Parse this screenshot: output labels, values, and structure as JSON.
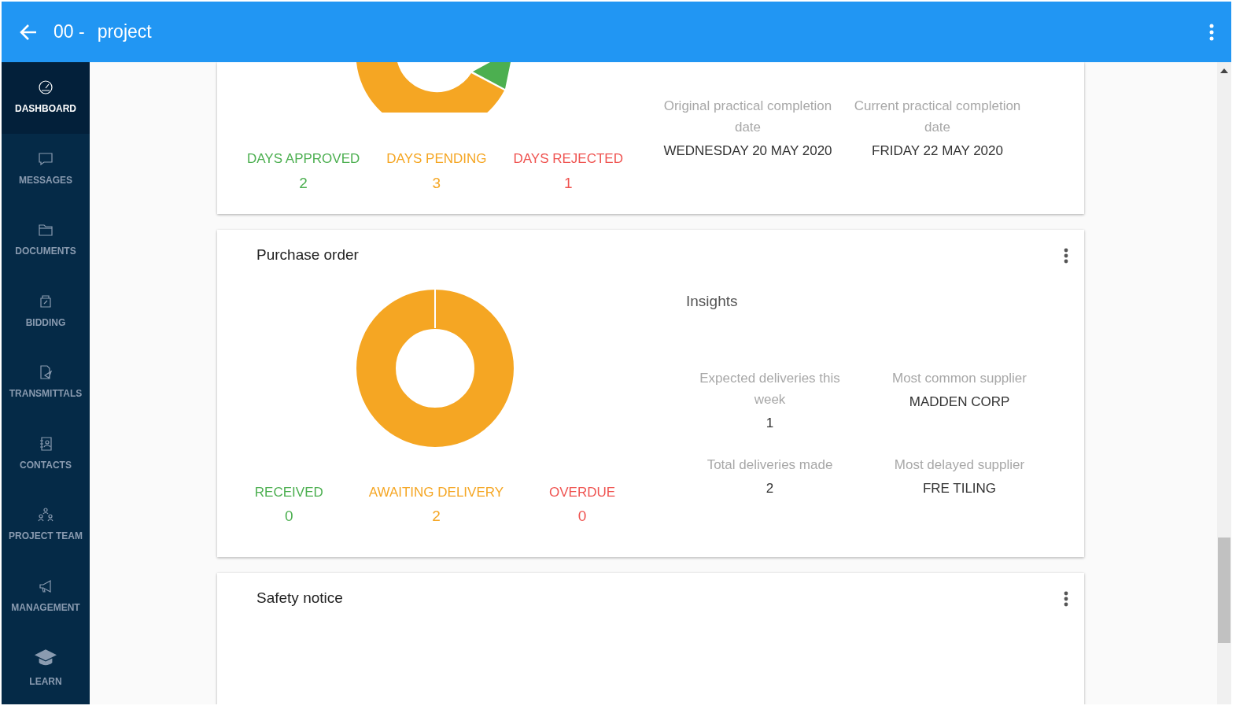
{
  "header": {
    "number": "00 -",
    "title": "project"
  },
  "sidebar": {
    "items": [
      {
        "label": "DASHBOARD",
        "kind": "gauge",
        "selected": true
      },
      {
        "label": "MESSAGES",
        "kind": "chat",
        "selected": false
      },
      {
        "label": "DOCUMENTS",
        "kind": "folder",
        "selected": false
      },
      {
        "label": "BIDDING",
        "kind": "bid",
        "selected": false
      },
      {
        "label": "TRANSMITTALS",
        "kind": "send",
        "selected": false
      },
      {
        "label": "CONTACTS",
        "kind": "contacts",
        "selected": false
      },
      {
        "label": "PROJECT TEAM",
        "kind": "team",
        "selected": false
      },
      {
        "label": "MANAGEMENT",
        "kind": "megaphone",
        "selected": false
      },
      {
        "label": "LEARN",
        "kind": "cap",
        "selected": false
      }
    ]
  },
  "time_card": {
    "stats": [
      {
        "label": "DAYS APPROVED",
        "value": "2",
        "color": "#4caf50"
      },
      {
        "label": "DAYS PENDING",
        "value": "3",
        "color": "#f5a623"
      },
      {
        "label": "DAYS REJECTED",
        "value": "1",
        "color": "#ef5350"
      }
    ],
    "insights": [
      {
        "label": "Original practical completion date",
        "value": "WEDNESDAY 20 MAY 2020"
      },
      {
        "label": "Current practical completion date",
        "value": "FRIDAY 22 MAY 2020"
      }
    ]
  },
  "purchase_card": {
    "title": "Purchase order",
    "stats": [
      {
        "label": "RECEIVED",
        "value": "0",
        "color": "#4caf50"
      },
      {
        "label": "AWAITING DELIVERY",
        "value": "2",
        "color": "#f5a623"
      },
      {
        "label": "OVERDUE",
        "value": "0",
        "color": "#ef5350"
      }
    ],
    "insights_title": "Insights",
    "insights": [
      {
        "label": "Expected deliveries this week",
        "value": "1"
      },
      {
        "label": "Most common supplier",
        "value": "MADDEN CORP"
      },
      {
        "label": "Total deliveries made",
        "value": "2"
      },
      {
        "label": "Most delayed supplier",
        "value": "FRE TILING"
      }
    ]
  },
  "safety_card": {
    "title": "Safety notice"
  }
}
